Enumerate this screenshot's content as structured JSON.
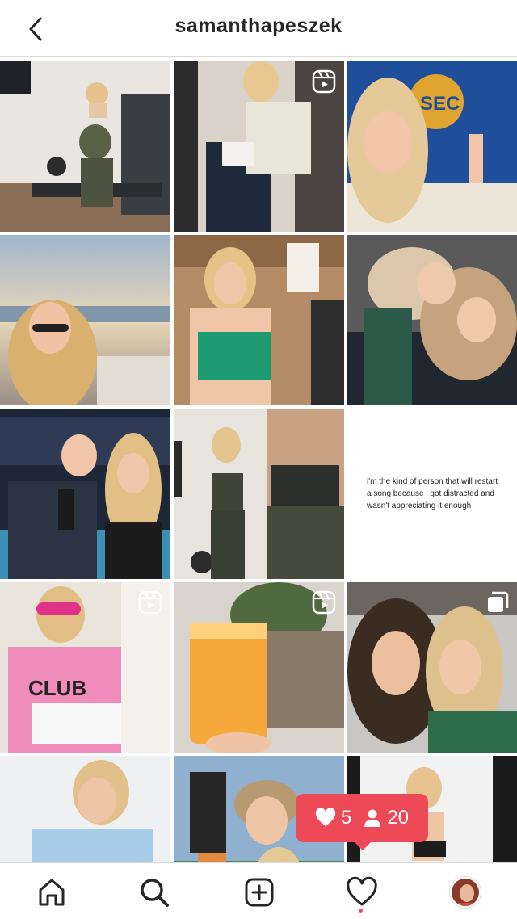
{
  "header": {
    "title": "samanthapeszek"
  },
  "grid": {
    "tiles": [
      {
        "badge": "none"
      },
      {
        "badge": "reel-icon"
      },
      {
        "badge": "none"
      },
      {
        "badge": "none"
      },
      {
        "badge": "none"
      },
      {
        "badge": "none"
      },
      {
        "badge": "none"
      },
      {
        "badge": "none"
      },
      {
        "badge": "none",
        "quote": "i'm the kind of person that will restart a song because i got distracted and wasn't appreciating it enough"
      },
      {
        "badge": "reel-icon"
      },
      {
        "badge": "reel-icon"
      },
      {
        "badge": "carousel-icon"
      },
      {
        "badge": "none"
      },
      {
        "badge": "none"
      },
      {
        "badge": "none"
      }
    ]
  },
  "activity": {
    "likes": "5",
    "followers": "20"
  },
  "nav": {
    "active_dot_color": "#ed4956"
  },
  "colors": {
    "accent": "#ed4956",
    "border": "#dbdbdb"
  }
}
